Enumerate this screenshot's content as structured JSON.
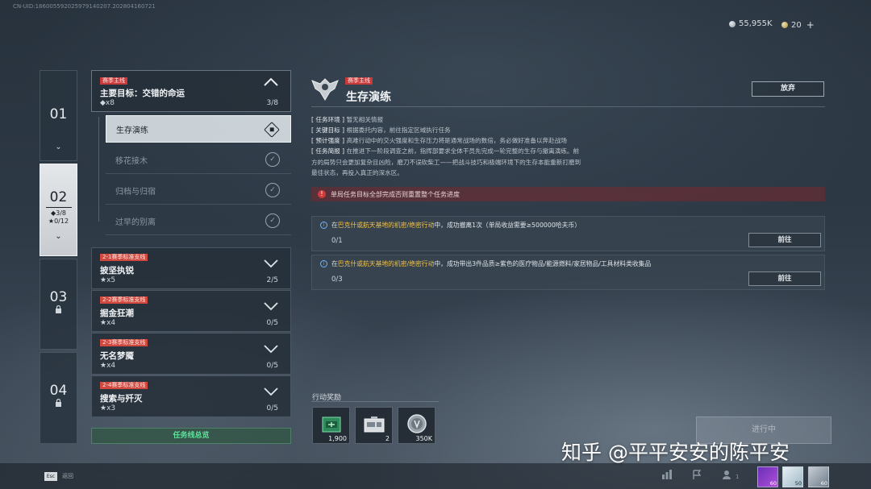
{
  "uid": "CN-UID:1860055920259791402​07.20280416​0721",
  "currency": {
    "coins": "55,955K",
    "premium": "20",
    "plus": "+"
  },
  "chapters": [
    {
      "num": "01",
      "chevron": "⌄"
    },
    {
      "num": "02",
      "diamonds": "◆3/8",
      "stars": "★0/12",
      "chevron": "⌄"
    },
    {
      "num": "03",
      "lock": "🔒"
    },
    {
      "num": "04",
      "lock": "🔒"
    }
  ],
  "main_task": {
    "tag": "赛季主线",
    "title": "主要目标：交错的命运",
    "meta": "◆x8",
    "progress": "3/8",
    "collapse": "︿"
  },
  "substeps": [
    {
      "label": "生存演练"
    },
    {
      "label": "移花接木"
    },
    {
      "label": "归档与归宿"
    },
    {
      "label": "过早的别离"
    }
  ],
  "side_tasks": [
    {
      "tag": "2-1赛季标准支线",
      "title": "披坚执锐",
      "meta": "★x5",
      "progress": "2/5",
      "expand": "﹀"
    },
    {
      "tag": "2-2赛季标准支线",
      "title": "掘金狂潮",
      "meta": "★x4",
      "progress": "0/5",
      "expand": "﹀"
    },
    {
      "tag": "2-3赛季标准支线",
      "title": "无名梦魇",
      "meta": "★x4",
      "progress": "0/5",
      "expand": "﹀"
    },
    {
      "tag": "2-4赛季标准支线",
      "title": "搜索与歼灭",
      "meta": "★x3",
      "progress": "0/5",
      "expand": "﹀"
    }
  ],
  "overview_button": "任务线总览",
  "detail": {
    "tag": "赛季主线",
    "title": "生存演练",
    "abandon": "放弃",
    "env_label": "[ 任务环境 ]",
    "env": "暂无相关情报",
    "goal_label": "[ 关键目标 ]",
    "goal": "根据委托内容，前往指定区域执行任务",
    "intensity_label": "[ 预计强度 ]",
    "intensity": "高难行动中的交火强度和生存压力将是通常战场的数倍，务必做好准备以奔赴战场",
    "brief_label": "[ 任务简报 ]",
    "brief_1": "在推进下一阶段调查之前，指挥部要求全体干员先完成一轮完整的生存与撤离演练。前",
    "brief_2": "方的局势只会更加复杂且凶险，磨刀不误砍柴工——把战斗技巧和极端环境下的生存本能重新打磨到",
    "brief_3": "最佳状态，再投入真正的深水区。",
    "warning": "单局任务目标全部完成否则重置整个任务进度",
    "warn_icon": "!"
  },
  "objectives": [
    {
      "pre": "在",
      "place": "巴克什或航天基地的机密/绝密行动",
      "post": "中，成功撤离1次（单局收益需要≥500000哈夫币）",
      "count": "0/1",
      "button": "前往"
    },
    {
      "pre": "在",
      "place": "巴克什或航天基地的机密/绝密行动",
      "post": "中，成功带出3件品质≥紫色的医疗物品/能源燃料/家居物品/工具材料类收集品",
      "count": "0/3",
      "button": "前往"
    }
  ],
  "rewards": {
    "label": "行动奖励",
    "items": [
      {
        "name": "green-supply-box",
        "qty": "1,900"
      },
      {
        "name": "equipment-case",
        "qty": "2"
      },
      {
        "name": "silver-coin",
        "qty": "350K"
      }
    ]
  },
  "in_progress": "进行中",
  "watermark": "知乎 @平平安安的陈平安",
  "bottom": {
    "esc": "Esc",
    "esc_label": "返回",
    "friends_count": "1"
  },
  "avatars": [
    {
      "level": "60"
    },
    {
      "level": "50"
    },
    {
      "level": "60"
    }
  ],
  "colors": {
    "accent_red": "#c83a3a",
    "accent_green": "#5fe09a",
    "highlight": "#f0c14a"
  }
}
